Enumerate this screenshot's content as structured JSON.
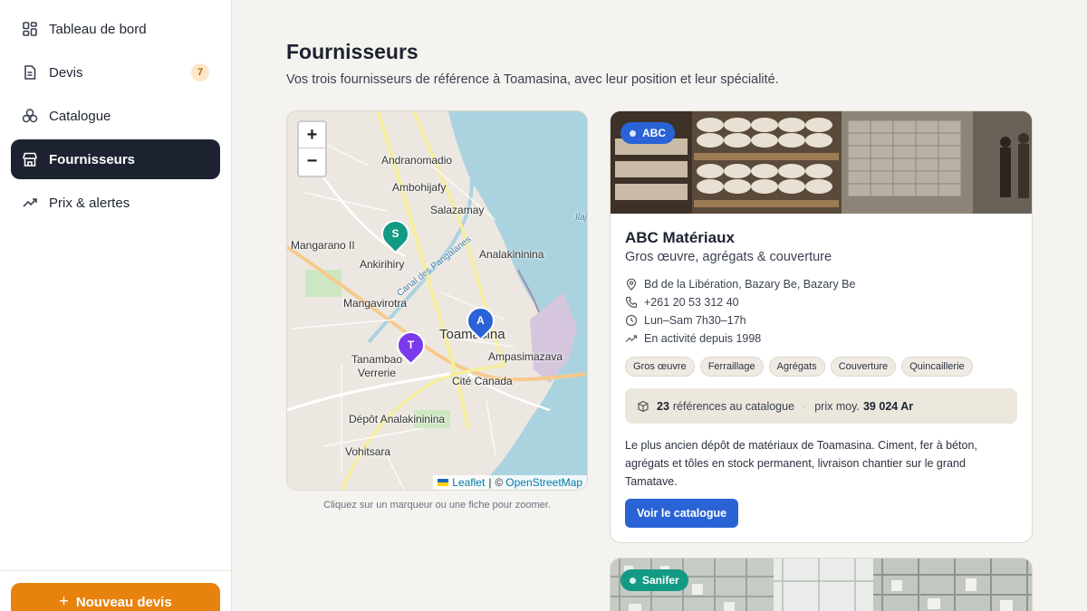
{
  "sidebar": {
    "items": [
      {
        "label": "Tableau de bord",
        "icon": "dashboard-icon"
      },
      {
        "label": "Devis",
        "icon": "document-icon",
        "badge": "7"
      },
      {
        "label": "Catalogue",
        "icon": "boxes-icon"
      },
      {
        "label": "Fournisseurs",
        "icon": "store-icon",
        "active": true
      },
      {
        "label": "Prix & alertes",
        "icon": "trend-icon"
      }
    ],
    "new_button": "Nouveau devis"
  },
  "page": {
    "title": "Fournisseurs",
    "subtitle": "Vos trois fournisseurs de référence à Toamasina, avec leur position et leur spécialité."
  },
  "map": {
    "zoom_in": "+",
    "zoom_out": "−",
    "attribution": {
      "leaflet": "Leaflet",
      "separator": "|",
      "copyright": "©",
      "osm": "OpenStreetMap"
    },
    "hint": "Cliquez sur un marqueur ou une fiche pour zoomer.",
    "place_labels": [
      "Andranomadio",
      "Ambohijafy",
      "Salazamay",
      "Mangarano II",
      "Ankirihiry",
      "Analakininina",
      "Mangavirotra",
      "Toamasina",
      "Ampasimazava",
      "Tanambao Verrerie",
      "Cité Canada",
      "Dépôt Analakininina",
      "Vohitsara",
      "Canal des Pangalanes",
      "Ilaj"
    ],
    "markers": [
      {
        "letter": "S",
        "color": "#139a85"
      },
      {
        "letter": "A",
        "color": "#2a63d6"
      },
      {
        "letter": "T",
        "color": "#7c3aed"
      }
    ]
  },
  "supplier": {
    "tag": "ABC",
    "tag_color": "#2a63d6",
    "name": "ABC Matériaux",
    "specialty": "Gros œuvre, agrégats & couverture",
    "address": "Bd de la Libération, Bazary Be, Bazary Be",
    "phone": "+261 20 53 312 40",
    "hours": "Lun–Sam 7h30–17h",
    "since": "En activité depuis 1998",
    "chips": [
      "Gros œuvre",
      "Ferraillage",
      "Agrégats",
      "Couverture",
      "Quincaillerie"
    ],
    "stats": {
      "refs_count": "23",
      "refs_label": "références au catalogue",
      "sep": "·",
      "price_label": "prix moy.",
      "price_value": "39 024 Ar"
    },
    "description": "Le plus ancien dépôt de matériaux de Toamasina. Ciment, fer à béton, agrégats et tôles en stock permanent, livraison chantier sur le grand Tamatave.",
    "button": "Voir le catalogue"
  },
  "supplier2": {
    "tag": "Sanifer",
    "tag_color": "#139a85"
  }
}
